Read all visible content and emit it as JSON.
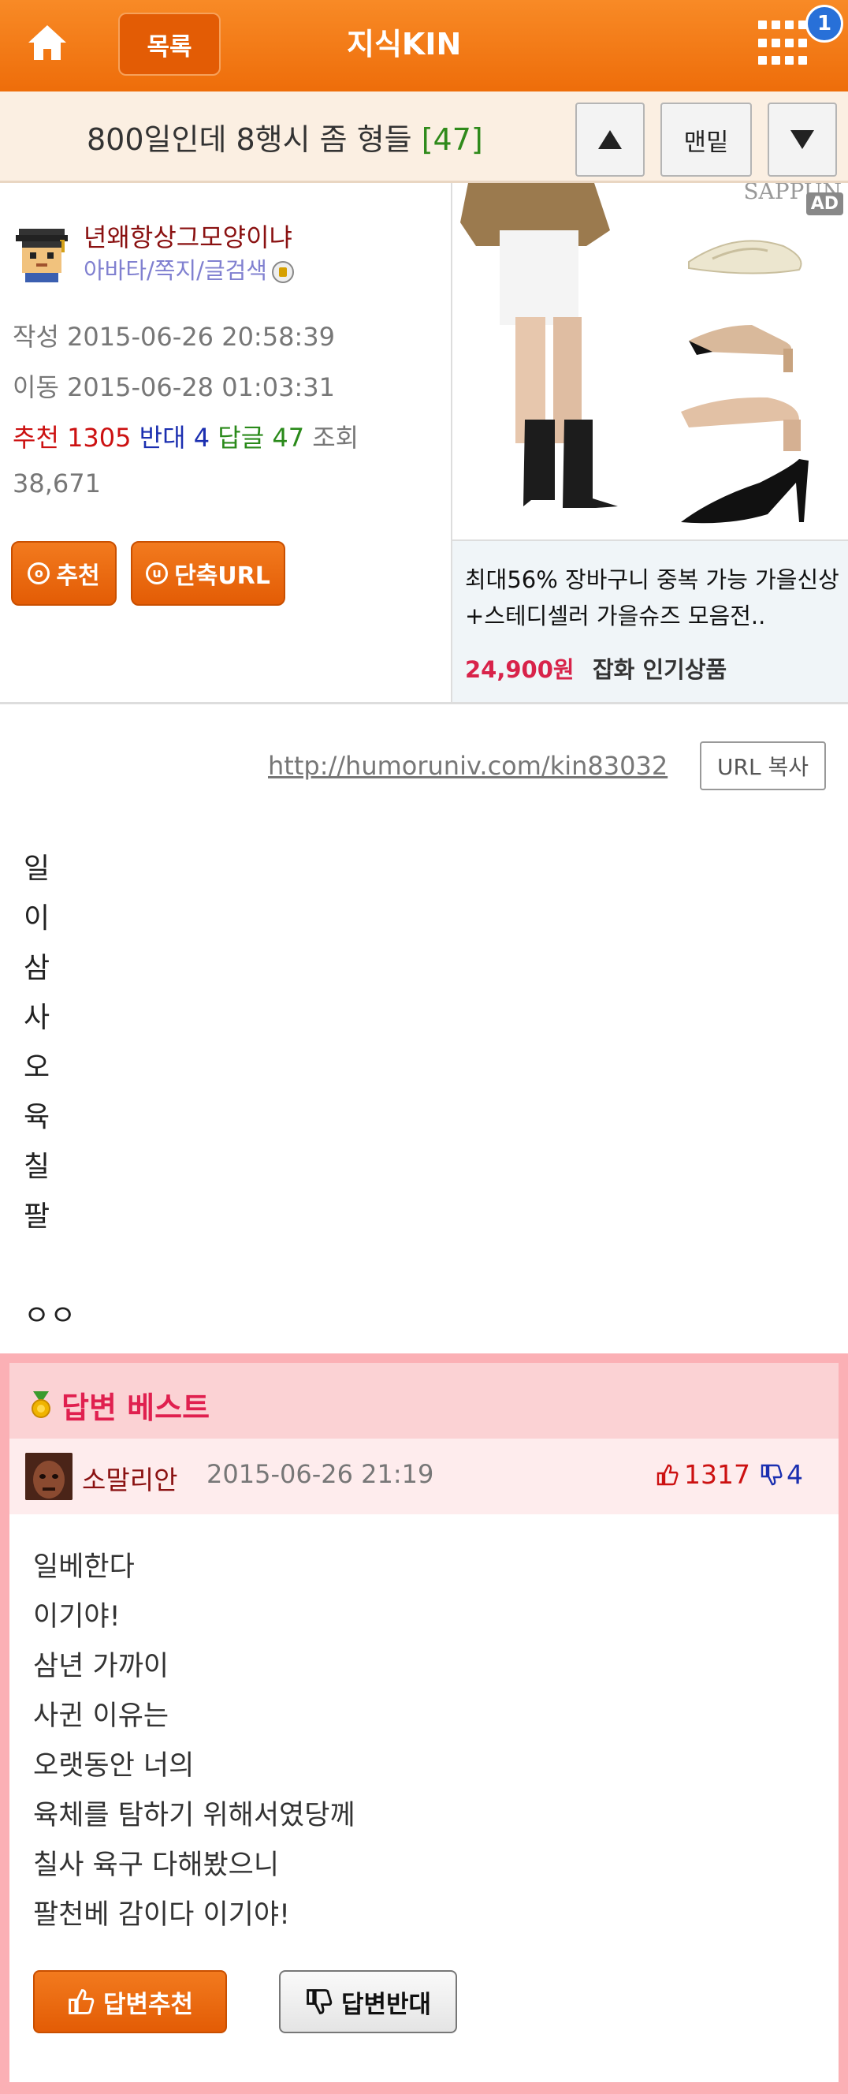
{
  "header": {
    "list_label": "목록",
    "title": "지식KIN",
    "notification_count": "1"
  },
  "post": {
    "title": "800일인데 8행시 좀 형들",
    "reply_count": "[47]",
    "nav_bottom_label": "맨밑",
    "author": {
      "name": "년왜항상그모양이냐",
      "links": "아바타/쪽지/글검색"
    },
    "created_label": "작성",
    "created": "2015-06-26 20:58:39",
    "moved_label": "이동",
    "moved": "2015-06-28 01:03:31",
    "stats": {
      "recommend_label": "추천",
      "recommend": "1305",
      "oppose_label": "반대",
      "oppose": "4",
      "reply_label": "답글",
      "reply": "47",
      "views_label": "조회",
      "views": "38,671"
    },
    "recommend_button": "추천",
    "short_url_button": "단축URL",
    "url": "http://humoruniv.com/kin83032",
    "copy_url_button": "URL 복사",
    "body_lines": [
      "일",
      "이",
      "삼",
      "사",
      "오",
      "육",
      "칠",
      "팔"
    ],
    "body_tail": "ㅇㅇ"
  },
  "ad": {
    "badge": "AD",
    "brand": "SAPPUN",
    "description": "최대56% 장바구니 중복 가능 가을신상+스테디셀러 가을슈즈 모음전..",
    "price": "24,900원",
    "category": "잡화 인기상품"
  },
  "best_answer": {
    "section_title": "답변 베스트",
    "author": "소말리안",
    "date": "2015-06-26 21:19",
    "up_count": "1317",
    "down_count": "4",
    "lines": [
      "일베한다",
      "이기야!",
      "삼년 가까이",
      "사귄 이유는",
      "오랫동안 너의",
      "육체를 탐하기 위해서였당께",
      "칠사 육구 다해봤으니",
      "팔천베 감이다 이기야!"
    ],
    "recommend_button": "답변추천",
    "oppose_button": "답변반대"
  },
  "colors": {
    "header_orange": "#f07a14",
    "best_pink": "#fbb0b5",
    "recommend_red": "#cc1111",
    "oppose_blue": "#1b2fb0",
    "reply_green": "#2a8a1a",
    "price_red": "#d8234a"
  },
  "icons": [
    "home-icon",
    "grid-menu-icon",
    "arrow-up-icon",
    "arrow-down-icon",
    "medal-icon",
    "thumbs-up-icon",
    "thumbs-down-icon"
  ]
}
